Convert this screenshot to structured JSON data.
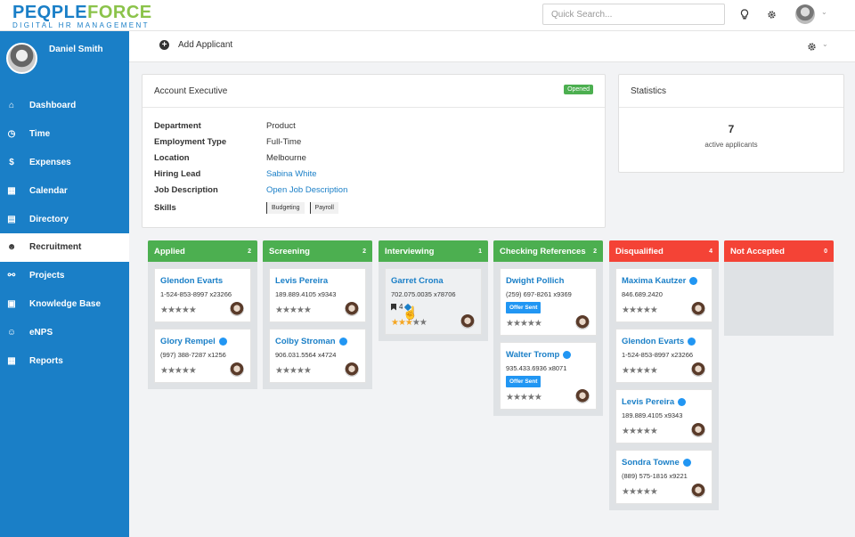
{
  "brand": {
    "logo_part1": "PEQPLE",
    "logo_part2": "FORCE",
    "tagline": "DIGITAL HR MANAGEMENT"
  },
  "topbar": {
    "search_placeholder": "Quick Search...",
    "icons": [
      "lightbulb-icon",
      "gear-icon",
      "chevron-down-icon"
    ]
  },
  "user": {
    "name": "Daniel Smith"
  },
  "nav": [
    {
      "label": "Dashboard",
      "icon": "home-icon",
      "glyph": "⌂"
    },
    {
      "label": "Time",
      "icon": "clock-icon",
      "glyph": "◷"
    },
    {
      "label": "Expenses",
      "icon": "dollar-icon",
      "glyph": "$"
    },
    {
      "label": "Calendar",
      "icon": "calendar-icon",
      "glyph": "▦"
    },
    {
      "label": "Directory",
      "icon": "address-book-icon",
      "glyph": "▤"
    },
    {
      "label": "Recruitment",
      "icon": "users-icon",
      "glyph": "☻",
      "active": true
    },
    {
      "label": "Projects",
      "icon": "sitemap-icon",
      "glyph": "⚯"
    },
    {
      "label": "Knowledge Base",
      "icon": "book-icon",
      "glyph": "▣"
    },
    {
      "label": "eNPS",
      "icon": "smile-icon",
      "glyph": "☺"
    },
    {
      "label": "Reports",
      "icon": "table-icon",
      "glyph": "▦"
    }
  ],
  "actionbar": {
    "add_label": "Add Applicant"
  },
  "job": {
    "title": "Account Executive",
    "status": "Opened",
    "fields": [
      {
        "label": "Department",
        "value": "Product"
      },
      {
        "label": "Employment Type",
        "value": "Full-Time"
      },
      {
        "label": "Location",
        "value": "Melbourne"
      },
      {
        "label": "Hiring Lead",
        "value": "Sabina White",
        "link": true
      },
      {
        "label": "Job Description",
        "value": "Open Job Description",
        "link": true
      }
    ],
    "skills_label": "Skills",
    "skills": [
      "Budgeting",
      "Payroll"
    ]
  },
  "stats": {
    "title": "Statistics",
    "value": "7",
    "label": "active applicants"
  },
  "colors": {
    "green": "#4caf50",
    "red": "#f44336",
    "blue": "#1a7fc7"
  },
  "columns": [
    {
      "title": "Applied",
      "count": "2",
      "color": "#4caf50",
      "cards": [
        {
          "name": "Glendon Evarts",
          "phone": "1-524-853-8997 x23266",
          "dot": false,
          "rating": 0
        },
        {
          "name": "Glory Rempel",
          "phone": "(997) 388-7287 x1256",
          "dot": true,
          "rating": 0
        }
      ]
    },
    {
      "title": "Screening",
      "count": "2",
      "color": "#4caf50",
      "cards": [
        {
          "name": "Levis Pereira",
          "phone": "189.889.4105 x9343",
          "dot": false,
          "rating": 0
        },
        {
          "name": "Colby Stroman",
          "phone": "906.031.5564 x4724",
          "dot": true,
          "rating": 0
        }
      ]
    },
    {
      "title": "Interviewing",
      "count": "1",
      "color": "#4caf50",
      "cards": [
        {
          "name": "Garret Crona",
          "phone": "702.075.0035 x78706",
          "dot": false,
          "rating": 3,
          "notes": "4",
          "hover": true
        }
      ]
    },
    {
      "title": "Checking References",
      "count": "2",
      "color": "#4caf50",
      "cards": [
        {
          "name": "Dwight Pollich",
          "phone": "(259) 697-8261 x9369",
          "dot": false,
          "rating": 0,
          "badge": "Offer Sent"
        },
        {
          "name": "Walter Tromp",
          "phone": "935.433.6936 x8071",
          "dot": true,
          "rating": 0,
          "badge": "Offer Sent"
        }
      ]
    },
    {
      "title": "Disqualified",
      "count": "4",
      "color": "#f44336",
      "cards": [
        {
          "name": "Maxima Kautzer",
          "phone": "846.689.2420",
          "dot": true,
          "rating": 0
        },
        {
          "name": "Glendon Evarts",
          "phone": "1-524-853-8997 x23266",
          "dot": true,
          "rating": 0
        },
        {
          "name": "Levis Pereira",
          "phone": "189.889.4105 x9343",
          "dot": true,
          "rating": 0
        },
        {
          "name": "Sondra Towne",
          "phone": "(889) 575-1816 x9221",
          "dot": true,
          "rating": 0
        }
      ]
    },
    {
      "title": "Not Accepted",
      "count": "0",
      "color": "#f44336",
      "cards": []
    }
  ]
}
